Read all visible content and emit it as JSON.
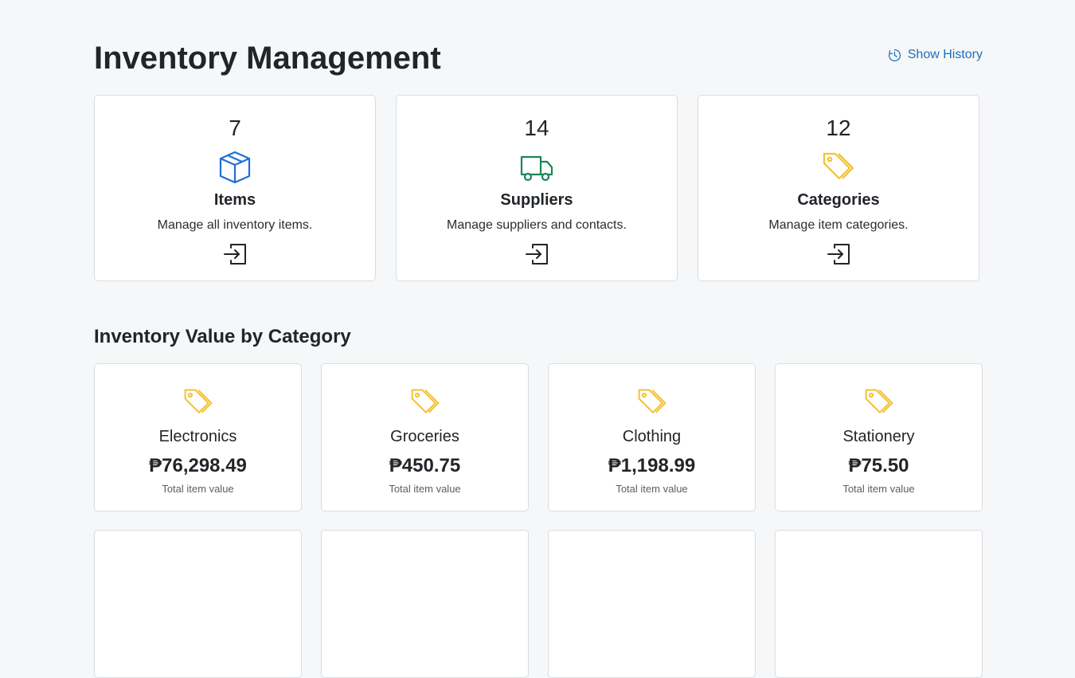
{
  "header": {
    "title": "Inventory Management",
    "history_label": "Show History",
    "history_icon": "clock-history-icon"
  },
  "summary": [
    {
      "count": "7",
      "title": "Items",
      "description": "Manage all inventory items.",
      "icon": "box-icon",
      "color": "#1f6fd6"
    },
    {
      "count": "14",
      "title": "Suppliers",
      "description": "Manage suppliers and contacts.",
      "icon": "truck-icon",
      "color": "#198754"
    },
    {
      "count": "12",
      "title": "Categories",
      "description": "Manage item categories.",
      "icon": "tags-icon",
      "color": "#f2c230"
    }
  ],
  "section": {
    "title": "Inventory Value by Category"
  },
  "categories": [
    {
      "name": "Electronics",
      "value": "₱76,298.49",
      "subtitle": "Total item value"
    },
    {
      "name": "Groceries",
      "value": "₱450.75",
      "subtitle": "Total item value"
    },
    {
      "name": "Clothing",
      "value": "₱1,198.99",
      "subtitle": "Total item value"
    },
    {
      "name": "Stationery",
      "value": "₱75.50",
      "subtitle": "Total item value"
    }
  ],
  "colors": {
    "accent": "#1f6fbf",
    "tag": "#f2c230",
    "background": "#f6f7f9"
  }
}
